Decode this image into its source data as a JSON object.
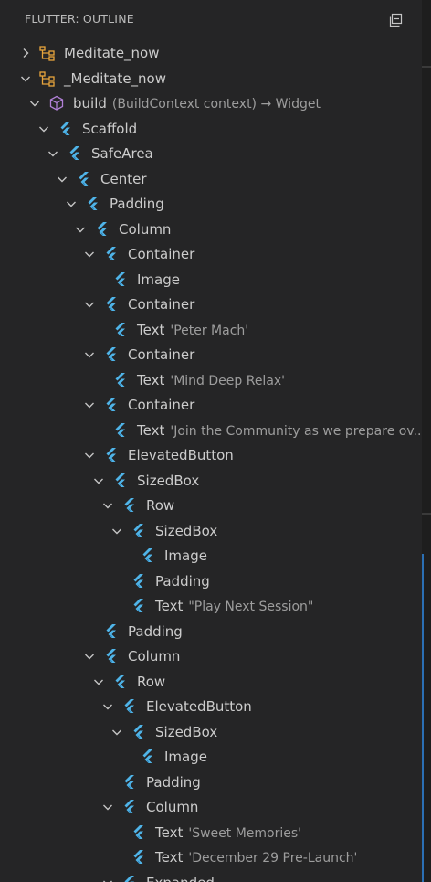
{
  "panel": {
    "title": "FLUTTER: OUTLINE",
    "collapse_all_icon": "collapse-all-icon"
  },
  "colors": {
    "class_icon": "#e8a53c",
    "method_icon": "#b180d7",
    "widget_icon": "#4fb4e8",
    "text": "#cccccc",
    "detail": "#9d9d9d"
  },
  "tree": [
    {
      "label": "Meditate_now",
      "detail": "",
      "icon": "class-icon",
      "depth": 0,
      "state": "collapsed"
    },
    {
      "label": "_Meditate_now",
      "detail": "",
      "icon": "class-icon",
      "depth": 0,
      "state": "expanded"
    },
    {
      "label": "build",
      "detail": "(BuildContext context) → Widget",
      "icon": "method-icon",
      "depth": 1,
      "state": "expanded"
    },
    {
      "label": "Scaffold",
      "detail": "",
      "icon": "flutter-widget-icon",
      "depth": 2,
      "state": "expanded"
    },
    {
      "label": "SafeArea",
      "detail": "",
      "icon": "flutter-widget-icon",
      "depth": 3,
      "state": "expanded"
    },
    {
      "label": "Center",
      "detail": "",
      "icon": "flutter-widget-icon",
      "depth": 4,
      "state": "expanded"
    },
    {
      "label": "Padding",
      "detail": "",
      "icon": "flutter-widget-icon",
      "depth": 5,
      "state": "expanded"
    },
    {
      "label": "Column",
      "detail": "",
      "icon": "flutter-widget-icon",
      "depth": 6,
      "state": "expanded"
    },
    {
      "label": "Container",
      "detail": "",
      "icon": "flutter-widget-icon",
      "depth": 7,
      "state": "expanded"
    },
    {
      "label": "Image",
      "detail": "",
      "icon": "flutter-widget-icon",
      "depth": 8,
      "state": "leaf"
    },
    {
      "label": "Container",
      "detail": "",
      "icon": "flutter-widget-icon",
      "depth": 7,
      "state": "expanded"
    },
    {
      "label": "Text",
      "detail": "'Peter Mach'",
      "icon": "flutter-widget-icon",
      "depth": 8,
      "state": "leaf"
    },
    {
      "label": "Container",
      "detail": "",
      "icon": "flutter-widget-icon",
      "depth": 7,
      "state": "expanded"
    },
    {
      "label": "Text",
      "detail": "'Mind Deep Relax'",
      "icon": "flutter-widget-icon",
      "depth": 8,
      "state": "leaf"
    },
    {
      "label": "Container",
      "detail": "",
      "icon": "flutter-widget-icon",
      "depth": 7,
      "state": "expanded"
    },
    {
      "label": "Text",
      "detail": "'Join the Community as we prepare ov...",
      "icon": "flutter-widget-icon",
      "depth": 8,
      "state": "leaf"
    },
    {
      "label": "ElevatedButton",
      "detail": "",
      "icon": "flutter-widget-icon",
      "depth": 7,
      "state": "expanded"
    },
    {
      "label": "SizedBox",
      "detail": "",
      "icon": "flutter-widget-icon",
      "depth": 8,
      "state": "expanded"
    },
    {
      "label": "Row",
      "detail": "",
      "icon": "flutter-widget-icon",
      "depth": 9,
      "state": "expanded"
    },
    {
      "label": "SizedBox",
      "detail": "",
      "icon": "flutter-widget-icon",
      "depth": 10,
      "state": "expanded"
    },
    {
      "label": "Image",
      "detail": "",
      "icon": "flutter-widget-icon",
      "depth": 11,
      "state": "leaf"
    },
    {
      "label": "Padding",
      "detail": "",
      "icon": "flutter-widget-icon",
      "depth": 10,
      "state": "leaf"
    },
    {
      "label": "Text",
      "detail": "\"Play Next Session\"",
      "icon": "flutter-widget-icon",
      "depth": 10,
      "state": "leaf"
    },
    {
      "label": "Padding",
      "detail": "",
      "icon": "flutter-widget-icon",
      "depth": 7,
      "state": "leaf"
    },
    {
      "label": "Column",
      "detail": "",
      "icon": "flutter-widget-icon",
      "depth": 7,
      "state": "expanded"
    },
    {
      "label": "Row",
      "detail": "",
      "icon": "flutter-widget-icon",
      "depth": 8,
      "state": "expanded"
    },
    {
      "label": "ElevatedButton",
      "detail": "",
      "icon": "flutter-widget-icon",
      "depth": 9,
      "state": "expanded"
    },
    {
      "label": "SizedBox",
      "detail": "",
      "icon": "flutter-widget-icon",
      "depth": 10,
      "state": "expanded"
    },
    {
      "label": "Image",
      "detail": "",
      "icon": "flutter-widget-icon",
      "depth": 11,
      "state": "leaf"
    },
    {
      "label": "Padding",
      "detail": "",
      "icon": "flutter-widget-icon",
      "depth": 9,
      "state": "leaf"
    },
    {
      "label": "Column",
      "detail": "",
      "icon": "flutter-widget-icon",
      "depth": 9,
      "state": "expanded"
    },
    {
      "label": "Text",
      "detail": "'Sweet Memories'",
      "icon": "flutter-widget-icon",
      "depth": 10,
      "state": "leaf"
    },
    {
      "label": "Text",
      "detail": "'December 29 Pre-Launch'",
      "icon": "flutter-widget-icon",
      "depth": 10,
      "state": "leaf"
    },
    {
      "label": "Expanded",
      "detail": "",
      "icon": "flutter-widget-icon",
      "depth": 9,
      "state": "expanded"
    }
  ]
}
